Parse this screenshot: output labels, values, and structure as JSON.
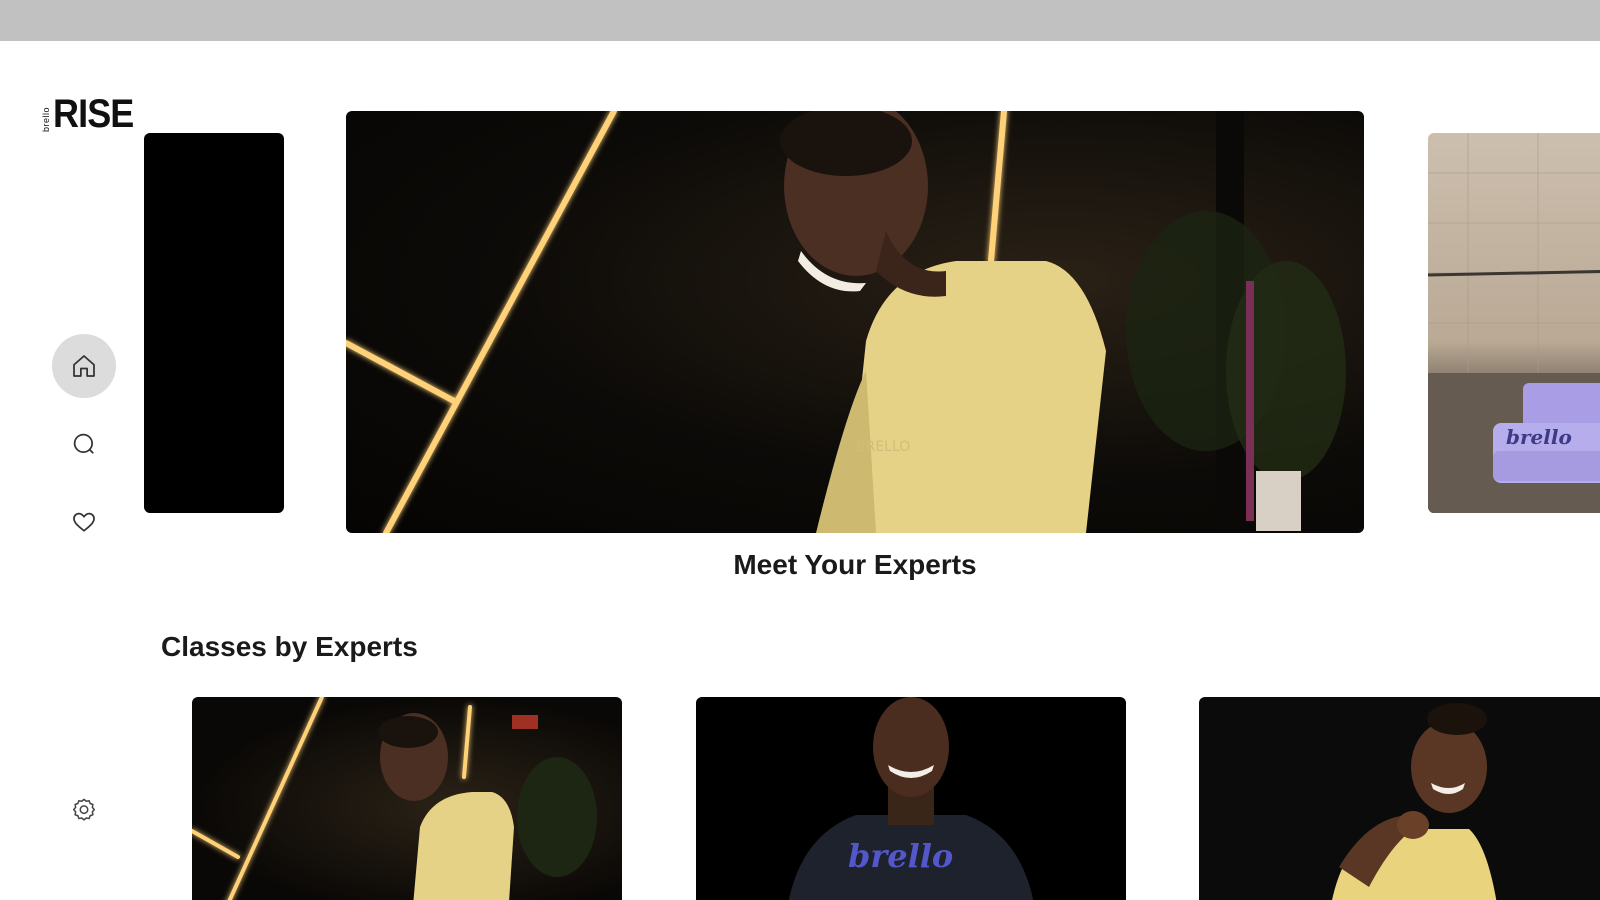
{
  "app": {
    "logo_small": "brello",
    "logo_main": "RISE"
  },
  "nav": {
    "items": [
      {
        "icon": "home-icon",
        "active": true
      },
      {
        "icon": "search-icon",
        "active": false
      },
      {
        "icon": "heart-icon",
        "active": false
      },
      {
        "icon": "gear-icon",
        "active": false
      }
    ]
  },
  "carousel": {
    "hero_caption": "Meet Your Experts",
    "right_card_brand": "brello"
  },
  "classes": {
    "section_title": "Classes by Experts",
    "cards": [
      {
        "brand": ""
      },
      {
        "brand": "brello"
      },
      {
        "brand": ""
      }
    ]
  },
  "colors": {
    "accent_glow": "#ffc15a",
    "hoodie": "#e8d487",
    "brand_purple": "#8d83d6",
    "nav_active_bg": "#dcdcdc"
  }
}
